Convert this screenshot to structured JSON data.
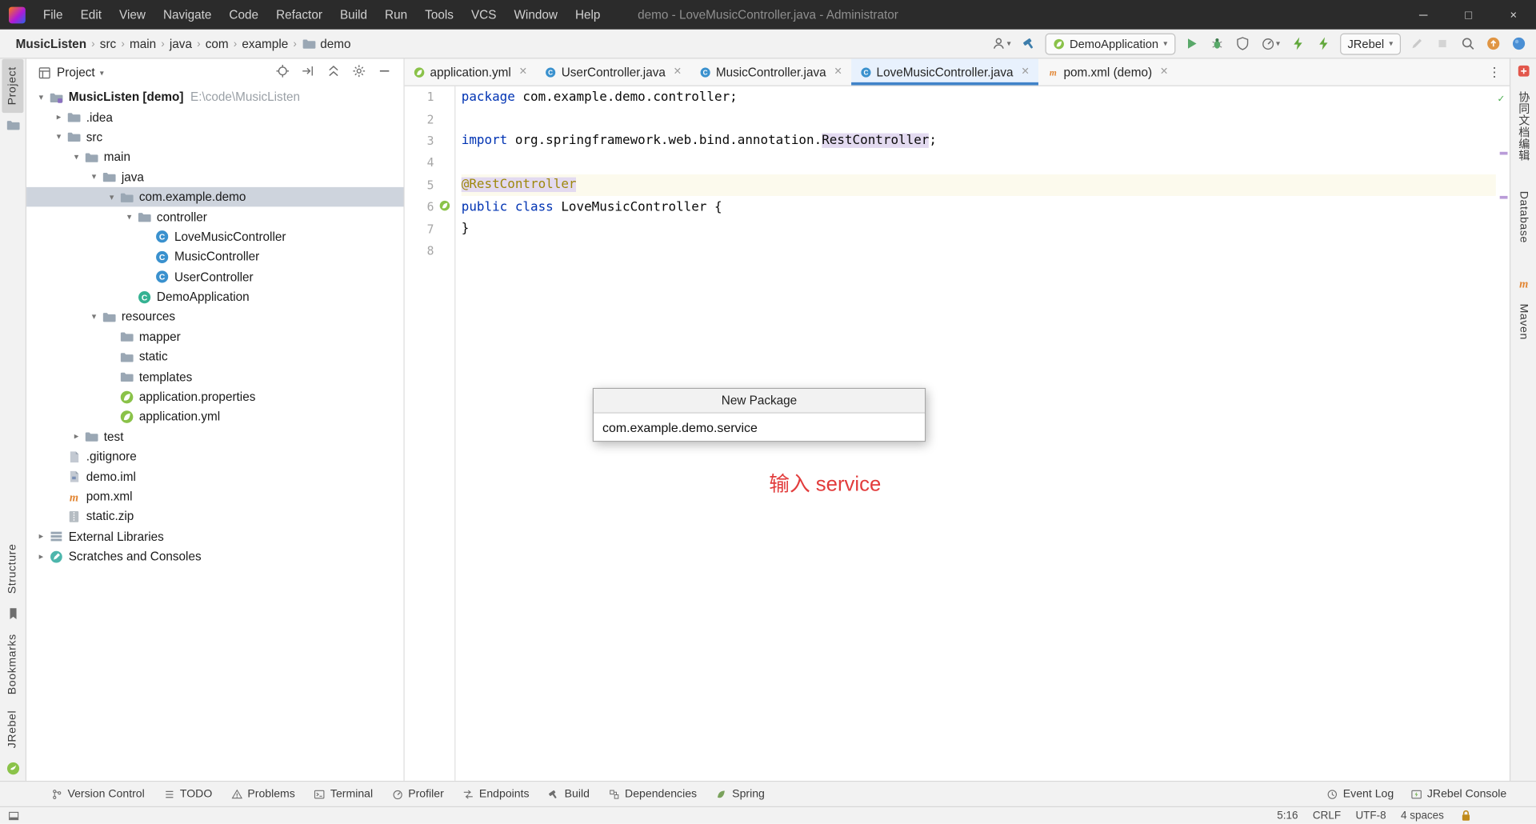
{
  "titlebar": {
    "menu": [
      "File",
      "Edit",
      "View",
      "Navigate",
      "Code",
      "Refactor",
      "Build",
      "Run",
      "Tools",
      "VCS",
      "Window",
      "Help"
    ],
    "title": "demo - LoveMusicController.java - Administrator",
    "window_controls": [
      "minimize",
      "maximize",
      "close"
    ]
  },
  "navbar": {
    "breadcrumbs": [
      "MusicListen",
      "src",
      "main",
      "java",
      "com",
      "example",
      "demo"
    ],
    "toolbar_items": [
      {
        "name": "user-menu",
        "glyph": "person",
        "dropdown": true
      },
      {
        "name": "build-project",
        "glyph": "hammer"
      },
      {
        "type": "combo",
        "name": "run-configuration",
        "glyph": "springleaf",
        "label": "DemoApplication"
      },
      {
        "name": "run-button",
        "glyph": "play"
      },
      {
        "name": "debug-button",
        "glyph": "bug"
      },
      {
        "name": "coverage-button",
        "glyph": "shield"
      },
      {
        "name": "profiler-button",
        "glyph": "gauge",
        "dropdown": true
      },
      {
        "name": "jrebel-run",
        "glyph": "bolt"
      },
      {
        "name": "jrebel-debug",
        "glyph": "bolt"
      },
      {
        "type": "combo",
        "name": "jrebel-selector",
        "label": "JRebel"
      },
      {
        "name": "edit-disabled",
        "glyph": "pencil",
        "disabled": true
      },
      {
        "name": "stop-disabled",
        "glyph": "stop",
        "disabled": true
      },
      {
        "name": "search-everywhere",
        "glyph": "search"
      },
      {
        "name": "updates",
        "glyph": "orangeup"
      },
      {
        "name": "notifications",
        "glyph": "bluecircle"
      }
    ]
  },
  "stripes": {
    "left_top": "Project",
    "left_bottom": [
      "Structure",
      "Bookmarks",
      "JRebel"
    ],
    "right": [
      "协同文档编辑",
      "Database",
      "Maven"
    ]
  },
  "project": {
    "header": "Project",
    "header_icons": [
      "locate",
      "scroll-from-source",
      "collapse-all",
      "settings",
      "hide"
    ],
    "tree": [
      {
        "depth": 0,
        "arrow": "open",
        "glyph": "projectroot",
        "label": "MusicListen [demo]",
        "sub": "E:\\code\\MusicListen",
        "bold": true
      },
      {
        "depth": 1,
        "arrow": "closed",
        "glyph": "folder",
        "label": ".idea"
      },
      {
        "depth": 1,
        "arrow": "open",
        "glyph": "folder",
        "label": "src"
      },
      {
        "depth": 2,
        "arrow": "open",
        "glyph": "folder",
        "label": "main"
      },
      {
        "depth": 3,
        "arrow": "open",
        "glyph": "folder",
        "label": "java"
      },
      {
        "depth": 4,
        "arrow": "open",
        "glyph": "folder",
        "label": "com.example.demo",
        "selected": true
      },
      {
        "depth": 5,
        "arrow": "open",
        "glyph": "folder",
        "label": "controller"
      },
      {
        "depth": 6,
        "glyph": "classblue",
        "label": "LoveMusicController"
      },
      {
        "depth": 6,
        "glyph": "classblue",
        "label": "MusicController"
      },
      {
        "depth": 6,
        "glyph": "classblue",
        "label": "UserController"
      },
      {
        "depth": 5,
        "glyph": "classteal",
        "label": "DemoApplication"
      },
      {
        "depth": 3,
        "arrow": "open",
        "glyph": "folder",
        "label": "resources"
      },
      {
        "depth": 4,
        "glyph": "folder",
        "label": "mapper"
      },
      {
        "depth": 4,
        "glyph": "folder",
        "label": "static"
      },
      {
        "depth": 4,
        "glyph": "folder",
        "label": "templates"
      },
      {
        "depth": 4,
        "glyph": "springleaf",
        "label": "application.properties"
      },
      {
        "depth": 4,
        "glyph": "springleaf",
        "label": "application.yml"
      },
      {
        "depth": 2,
        "arrow": "closed",
        "glyph": "folder",
        "label": "test"
      },
      {
        "depth": 1,
        "glyph": "doc",
        "label": ".gitignore"
      },
      {
        "depth": 1,
        "glyph": "iml",
        "label": "demo.iml"
      },
      {
        "depth": 1,
        "glyph": "maven",
        "label": "pom.xml"
      },
      {
        "depth": 1,
        "glyph": "zip",
        "label": "static.zip"
      },
      {
        "depth": 0,
        "arrow": "closed",
        "glyph": "lib",
        "label": "External Libraries"
      },
      {
        "depth": 0,
        "arrow": "closed",
        "glyph": "scratch",
        "label": "Scratches and Consoles"
      }
    ]
  },
  "tabs": [
    {
      "label": "application.yml",
      "glyph": "springleaf"
    },
    {
      "label": "UserController.java",
      "glyph": "classblue"
    },
    {
      "label": "MusicController.java",
      "glyph": "classblue"
    },
    {
      "label": "LoveMusicController.java",
      "glyph": "classblue",
      "active": true
    },
    {
      "label": "pom.xml (demo)",
      "glyph": "maven"
    }
  ],
  "code": {
    "lines": [
      {
        "n": 1,
        "segments": [
          {
            "text": "package ",
            "style": "keyword"
          },
          {
            "text": "com.example.demo.controller;",
            "style": "plain"
          }
        ]
      },
      {
        "n": 2,
        "segments": []
      },
      {
        "n": 3,
        "segments": [
          {
            "text": "import ",
            "style": "keyword"
          },
          {
            "text": "org.springframework.web.bind.annotation.",
            "style": "plain"
          },
          {
            "text": "RestController",
            "style": "plain",
            "usage": true
          },
          {
            "text": ";",
            "style": "plain"
          }
        ]
      },
      {
        "n": 4,
        "segments": []
      },
      {
        "n": 5,
        "current": true,
        "segments": [
          {
            "text": "@RestController",
            "style": "annotation",
            "usage": true
          }
        ]
      },
      {
        "n": 6,
        "gutter_icon": "springleaf",
        "segments": [
          {
            "text": "public class ",
            "style": "keyword"
          },
          {
            "text": "LoveMusicController {",
            "style": "plain"
          }
        ]
      },
      {
        "n": 7,
        "segments": [
          {
            "text": "}",
            "style": "plain"
          }
        ]
      },
      {
        "n": 8,
        "segments": []
      }
    ]
  },
  "dialog": {
    "title": "New Package",
    "value": "com.example.demo.service"
  },
  "annotation": {
    "text": "输入 service",
    "color": "#e23c3c"
  },
  "bottom_bar": {
    "left": [
      {
        "label": "Version Control",
        "glyph": "vcs"
      },
      {
        "label": "TODO",
        "glyph": "todo"
      },
      {
        "label": "Problems",
        "glyph": "warn"
      },
      {
        "label": "Terminal",
        "glyph": "terminal"
      },
      {
        "label": "Profiler",
        "glyph": "gauge"
      },
      {
        "label": "Endpoints",
        "glyph": "endpoints"
      },
      {
        "label": "Build",
        "glyph": "hammergray"
      },
      {
        "label": "Dependencies",
        "glyph": "deps"
      },
      {
        "label": "Spring",
        "glyph": "springgray"
      }
    ],
    "right": [
      {
        "label": "Event Log",
        "glyph": "clock"
      },
      {
        "label": "JRebel Console",
        "glyph": "console"
      }
    ]
  },
  "status_bar": {
    "items": [
      "5:16",
      "CRLF",
      "UTF-8",
      "4 spaces"
    ]
  },
  "colors": {
    "keyword": "#0033b3",
    "annotation": "#9e880d",
    "usage_bg": "#e3daf0",
    "current_line": "#fcfaed",
    "tab_underline": "#4083c9",
    "tree_selection": "#ced4dd",
    "accent_red": "#e23c3c",
    "titlebar_bg": "#2b2b2b"
  }
}
